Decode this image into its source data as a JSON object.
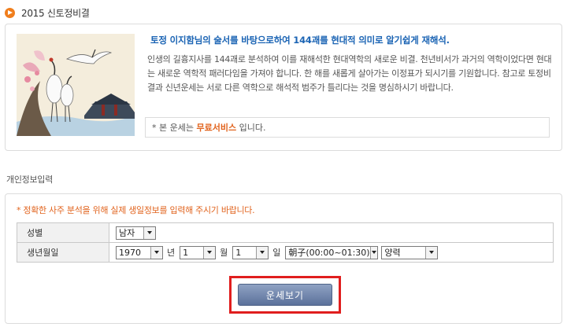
{
  "header": {
    "title": "2015 신토정비결"
  },
  "intro": {
    "headline": "토정 이지함님의 술서를 바탕으로하여 144괘를 현대적 의미로 알기쉽게 재해석.",
    "description": "인생의 길흉지사를 144괘로 분석하여 이를 재해석한 현대역학의 새로운 비결. 천년비서가 과거의 역학이었다면 현대는 새로운 역학적 패러다임을 가져야 합니다. 한 해를 새롭게 살아가는 이정표가 되시기를 기원합니다. 참고로 토정비결과 신년운세는 서로 다른 역학으로 해석적 범주가 틀리다는 것을 명심하시기 바랍니다.",
    "free_prefix": "* 본 운세는",
    "free_emphasis": "무료서비스",
    "free_suffix": "입니다."
  },
  "form": {
    "section_label": "개인정보입력",
    "notice": "* 정확한 사주 분석을 위해 실제 생일정보를 입력해 주시기 바랍니다.",
    "gender_label": "성별",
    "gender_value": "남자",
    "birth_label": "생년월일",
    "year_value": "1970",
    "year_unit": "년",
    "month_value": "1",
    "month_unit": "월",
    "day_value": "1",
    "day_unit": "일",
    "hour_value": "朝子(00:00~01:30)",
    "calendar_value": "양력",
    "submit_label": "운세보기"
  },
  "colors": {
    "accent": "#f07e1c",
    "headline": "#1b64b4",
    "emphasis": "#e1631d",
    "button": "#6f84ab",
    "highlight_frame": "#e01e1e"
  }
}
